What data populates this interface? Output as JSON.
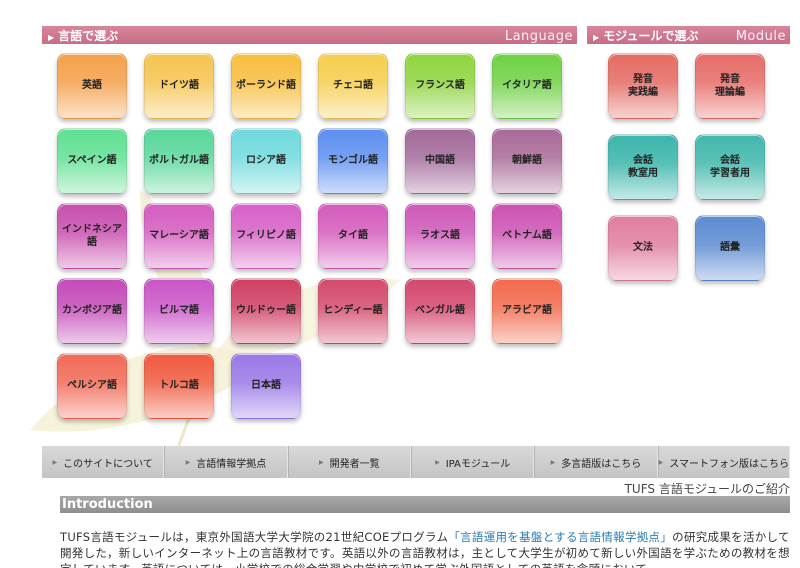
{
  "headers": {
    "language_jp": "言語で選ぶ",
    "language_en": "Language",
    "module_jp": "モジュールで選ぶ",
    "module_en": "Module"
  },
  "languages": [
    {
      "label": "英語",
      "color": "#f4a04a"
    },
    {
      "label": "ドイツ語",
      "color": "#f6c450"
    },
    {
      "label": "ポーランド語",
      "color": "#f7be3e"
    },
    {
      "label": "チェコ語",
      "color": "#f6cd4d"
    },
    {
      "label": "フランス語",
      "color": "#8fd43e"
    },
    {
      "label": "イタリア語",
      "color": "#6fd144"
    },
    {
      "label": "スペイン語",
      "color": "#5fe092"
    },
    {
      "label": "ポルトガル語",
      "color": "#58d79a"
    },
    {
      "label": "ロシア語",
      "color": "#6fd9dd"
    },
    {
      "label": "モンゴル語",
      "color": "#5d8ff0"
    },
    {
      "label": "中国語",
      "color": "#a26a9a"
    },
    {
      "label": "朝鮮語",
      "color": "#a86a98"
    },
    {
      "label": "インドネシア語",
      "color": "#c84fae"
    },
    {
      "label": "マレーシア語",
      "color": "#d45cc0"
    },
    {
      "label": "フィリピノ語",
      "color": "#d660c7"
    },
    {
      "label": "タイ語",
      "color": "#d35bbc"
    },
    {
      "label": "ラオス語",
      "color": "#cf58b8"
    },
    {
      "label": "ベトナム語",
      "color": "#cb52b2"
    },
    {
      "label": "カンボジア語",
      "color": "#c44ab8"
    },
    {
      "label": "ビルマ語",
      "color": "#ca55c6"
    },
    {
      "label": "ウルドゥー語",
      "color": "#cf3f62"
    },
    {
      "label": "ヒンディー語",
      "color": "#d44a6c"
    },
    {
      "label": "ベンガル語",
      "color": "#d3476e"
    },
    {
      "label": "アラビア語",
      "color": "#f26a4c"
    },
    {
      "label": "ペルシア語",
      "color": "#f16955"
    },
    {
      "label": "トルコ語",
      "color": "#f05a3f"
    },
    {
      "label": "日本語",
      "color": "#9a78e6"
    }
  ],
  "modules": [
    {
      "label": "発音\n実践編",
      "color": "#e46b62"
    },
    {
      "label": "発音\n理論編",
      "color": "#e66c68"
    },
    {
      "label": "会話\n教室用",
      "color": "#3bb5aa"
    },
    {
      "label": "会話\n学習者用",
      "color": "#42b7ac"
    },
    {
      "label": "文法",
      "color": "#e07ea0"
    },
    {
      "label": "語彙",
      "color": "#5b8bd1"
    }
  ],
  "nav": [
    "このサイトについて",
    "言語情報学拠点",
    "開発者一覧",
    "IPAモジュール",
    "多言語版はこちら",
    "スマートフォン版はこちら"
  ],
  "intro": {
    "caption": "TUFS 言語モジュールのご紹介",
    "heading": "Introduction",
    "text_before": "TUFS言語モジュールは，東京外国語大学大学院の21世紀COEプログラム",
    "link": "「言語運用を基盤とする言語情報学拠点」",
    "text_after": "の研究成果を活かして開発した，新しいインターネット上の言語教材です。英語以外の言語教材は，主として大学生が初めて新しい外国語を学ぶための教材を想定しています。英語については，小学校での総合学習や中学校で初めて学ぶ外国語としての英語を念頭において"
  }
}
